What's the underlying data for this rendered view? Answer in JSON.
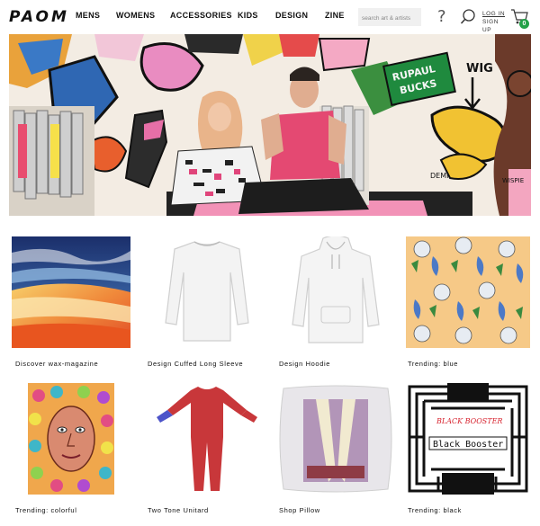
{
  "brand": {
    "logo_text": "PAOM"
  },
  "nav": {
    "items": [
      "MENS",
      "WOMENS",
      "ACCESSORIES",
      "KIDS",
      "DESIGN",
      "ZINE"
    ],
    "search_placeholder": "search art & artists",
    "help_icon": "question-mark-icon",
    "search_icon": "magnifier-icon",
    "login_label": "LOG IN",
    "signup_label": "SIGN UP",
    "cart_icon": "cart-icon",
    "cart_count": "0"
  },
  "hero": {
    "signs": {
      "rupaul_line1": "RUPAUL",
      "rupaul_line2": "BUCKS",
      "wig": "WIG",
      "demi": "DEMI",
      "wispie": "WISPIE"
    }
  },
  "products": [
    {
      "caption": "Discover wax-magazine"
    },
    {
      "caption": "Design Cuffed Long Sleeve"
    },
    {
      "caption": "Design Hoodie"
    },
    {
      "caption": "Trending: blue"
    },
    {
      "caption": "Trending: colorful"
    },
    {
      "caption": "Two Tone Unitard"
    },
    {
      "caption": "Shop Pillow"
    },
    {
      "caption": "Trending: black",
      "art_text_1": "BLACK BOOSTER",
      "art_text_2": "Black Booster"
    }
  ],
  "colors": {
    "accent_green": "#24a148",
    "search_bg": "#f0f0f0"
  }
}
